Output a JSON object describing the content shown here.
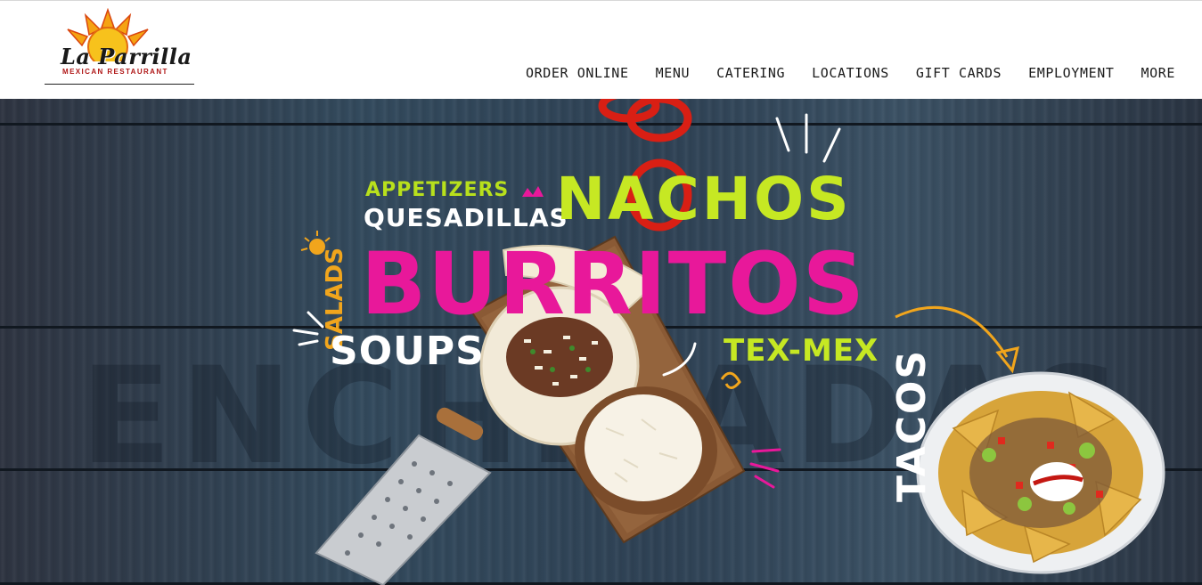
{
  "brand": {
    "name": "La Parrilla",
    "tagline": "MEXICAN RESTAURANT"
  },
  "nav": {
    "items": [
      {
        "label": "ORDER ONLINE"
      },
      {
        "label": "MENU"
      },
      {
        "label": "CATERING"
      },
      {
        "label": "LOCATIONS"
      },
      {
        "label": "GIFT CARDS"
      },
      {
        "label": "EMPLOYMENT"
      },
      {
        "label": "MORE"
      }
    ]
  },
  "hero": {
    "words": {
      "appetizers": "APPETIZERS",
      "quesadillas": "QUESADILLAS",
      "nachos": "NACHOS",
      "burritos": "BURRITOS",
      "salads": "SALADS",
      "soups": "SOUPS",
      "texmex": "TEX-MEX",
      "tacos": "TACOS",
      "background": "ENCHILADAS"
    },
    "colors": {
      "lime": "#c6e823",
      "magenta": "#e8189a",
      "orange": "#f1a51c",
      "white": "#ffffff"
    }
  }
}
